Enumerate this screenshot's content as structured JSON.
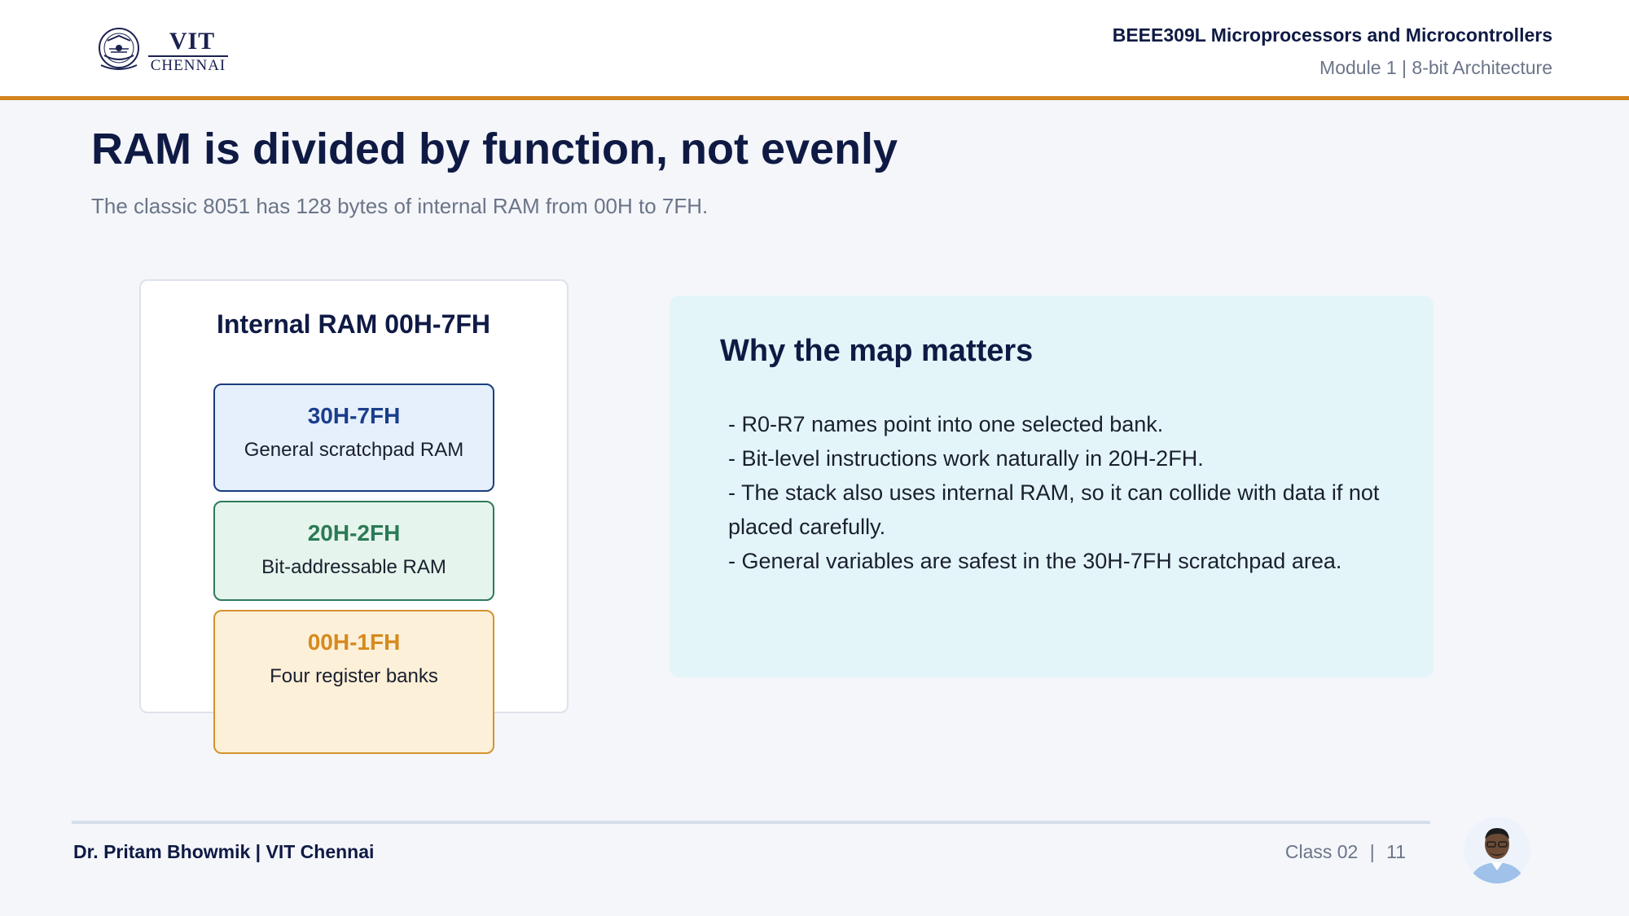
{
  "header": {
    "logo": {
      "primary": "VIT",
      "secondary": "CHENNAI",
      "emblem_icon": "vit-emblem-icon"
    },
    "course": "BEEE309L Microprocessors and Microcontrollers",
    "module": "Module 1 | 8-bit Architecture"
  },
  "slide": {
    "title": "RAM is divided by function, not evenly",
    "subtitle": "The classic 8051 has 128 bytes of internal RAM from 00H to 7FH."
  },
  "ram_map": {
    "title": "Internal RAM 00H-7FH",
    "regions": [
      {
        "range": "30H-7FH",
        "label": "General scratchpad RAM",
        "color": "#1a3d8c"
      },
      {
        "range": "20H-2FH",
        "label": "Bit-addressable RAM",
        "color": "#2a7a55"
      },
      {
        "range": "00H-1FH",
        "label": "Four register banks",
        "color": "#d68a1e"
      }
    ]
  },
  "notes": {
    "title": "Why the map matters",
    "items": [
      "- R0-R7 names point into one selected bank.",
      "- Bit-level instructions work naturally in 20H-2FH.",
      "- The stack also uses internal RAM, so it can collide with data if not placed carefully.",
      "- General variables are safest in the 30H-7FH scratchpad area."
    ]
  },
  "footer": {
    "author": "Dr. Pritam Bhowmik | VIT Chennai",
    "class_label": "Class 02",
    "separator": "|",
    "page": "11",
    "avatar_icon": "presenter-avatar"
  },
  "colors": {
    "accent": "#d4841f",
    "navy": "#0f1a44",
    "muted": "#6b7588",
    "info_bg": "#e3f5f9"
  }
}
